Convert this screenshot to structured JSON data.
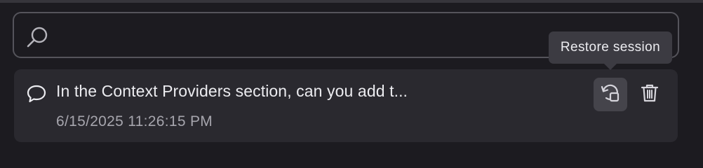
{
  "search": {
    "value": "",
    "placeholder": "",
    "icon": "search-icon"
  },
  "sessions": [
    {
      "title": "In the Context Providers section, can you add t...",
      "timestamp": "6/15/2025 11:26:15 PM",
      "icon": "chat-bubble-icon",
      "actions": {
        "restore_icon": "restore-session-icon",
        "delete_icon": "trash-icon"
      }
    }
  ],
  "tooltip": {
    "text": "Restore session"
  },
  "colors": {
    "background": "#1c1b20",
    "card": "#2a292f",
    "border": "#55545b",
    "tooltip": "#3c3b42",
    "text": "#ececf0",
    "muted_text": "#a6a5ad"
  }
}
